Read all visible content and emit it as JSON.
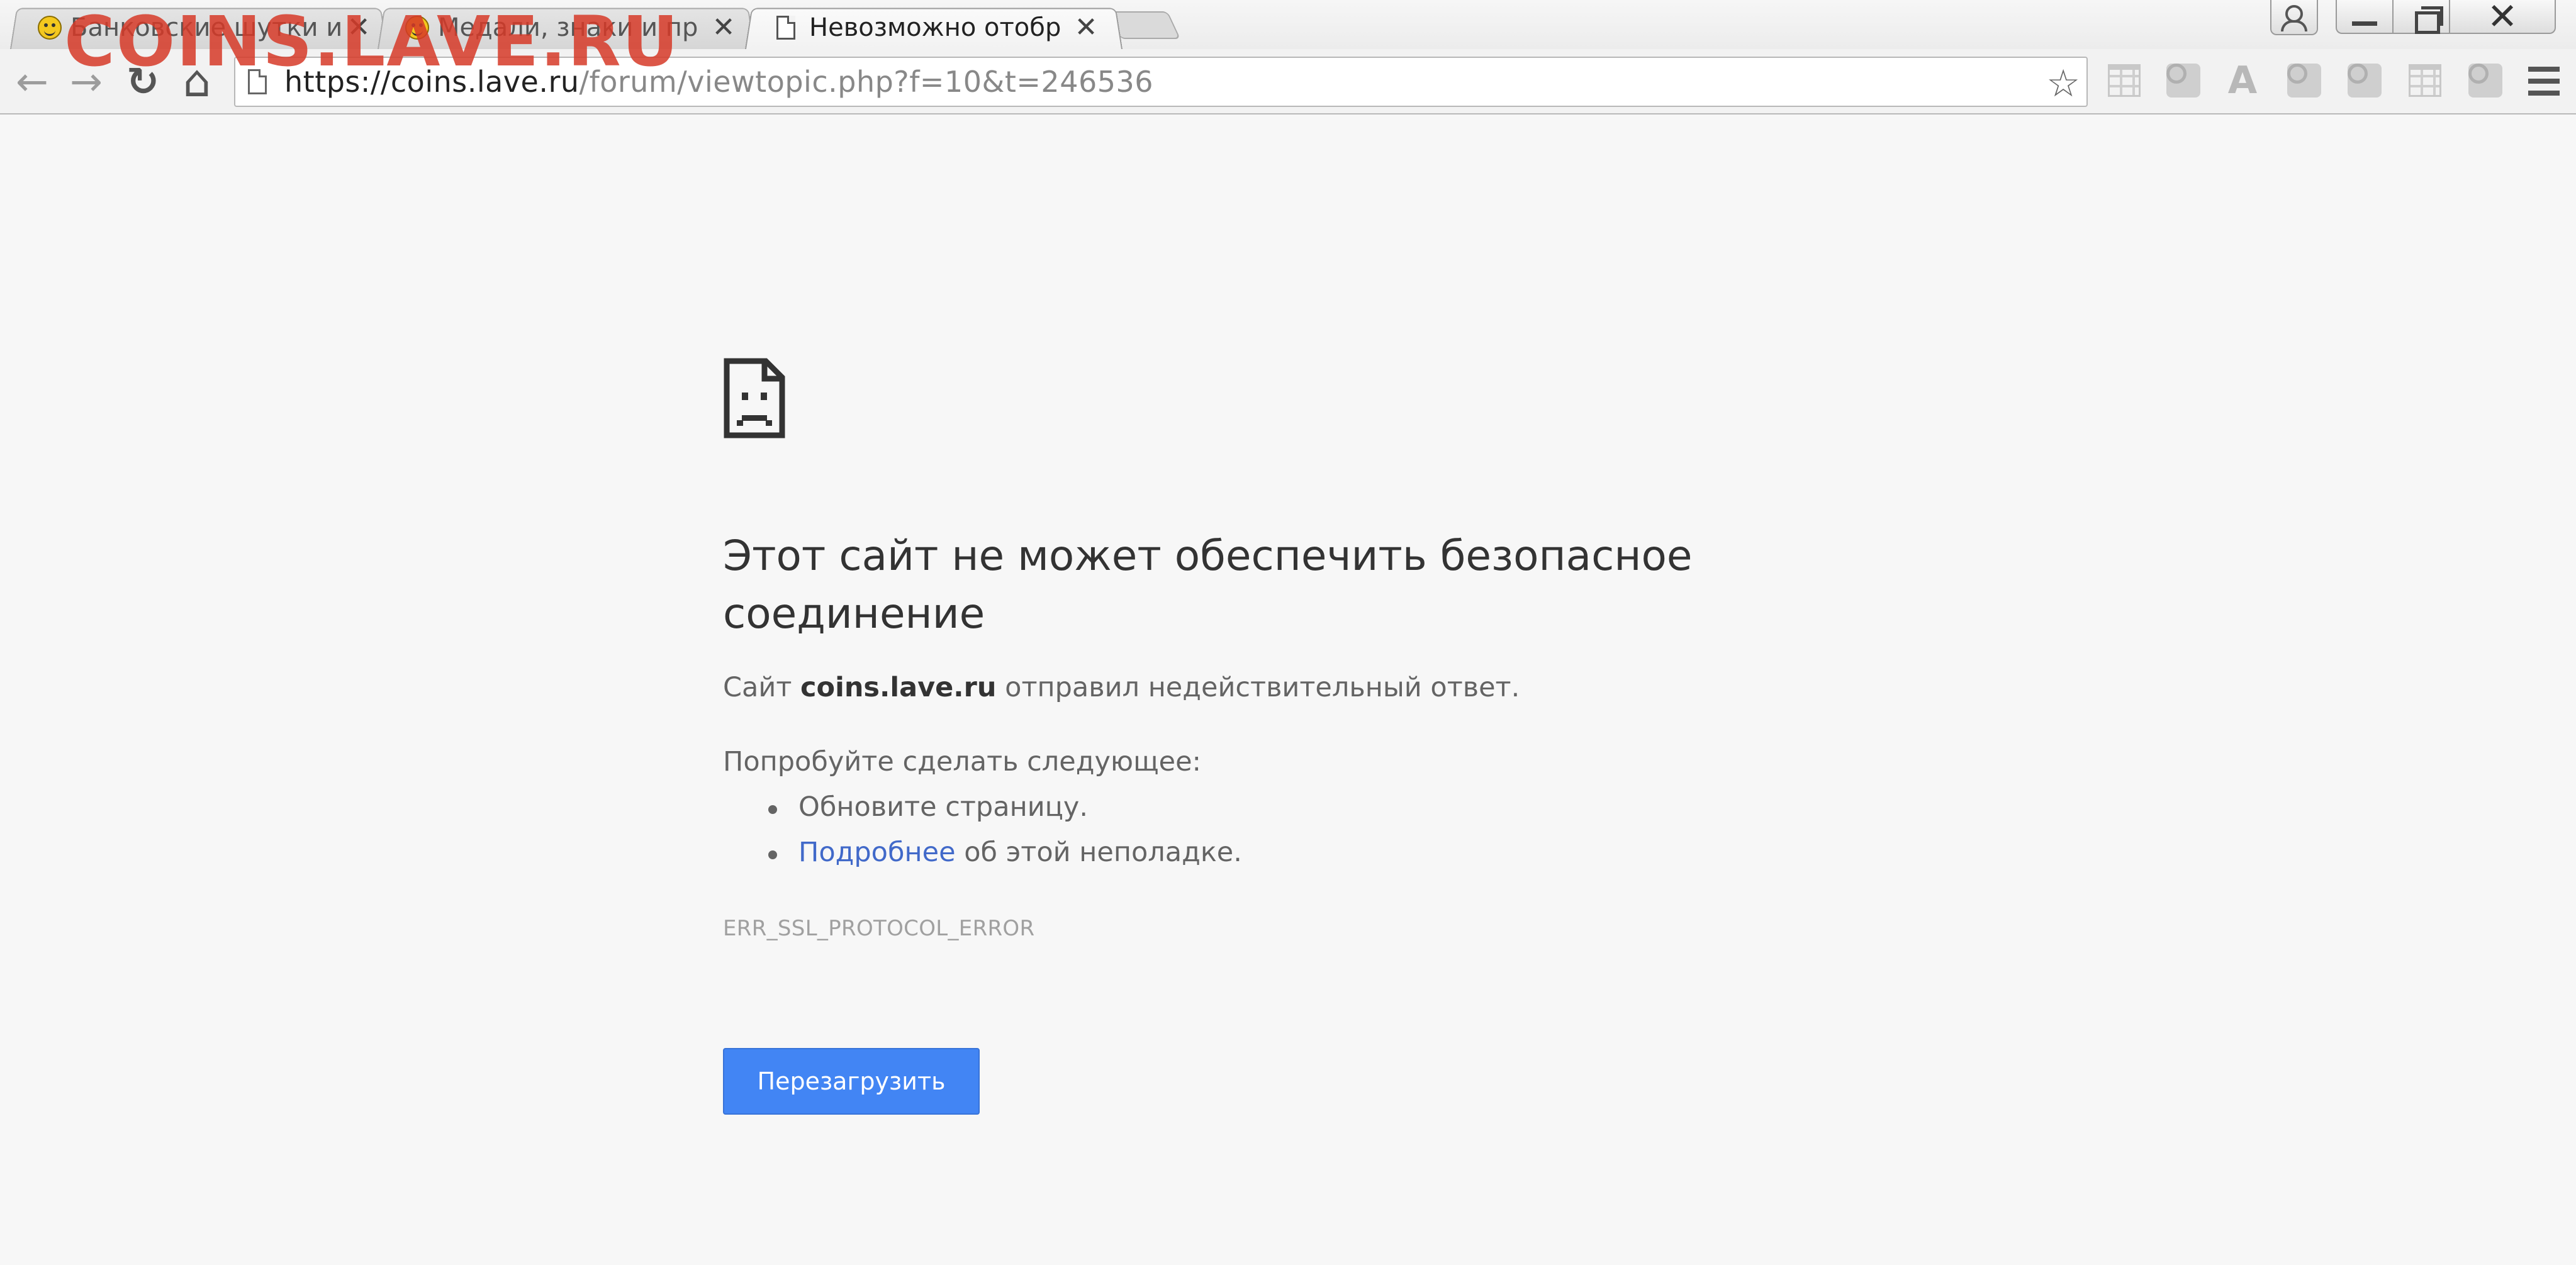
{
  "watermark": "COINS.LAVE.RU",
  "tabs": [
    {
      "title": "Банковские шутки и",
      "close": "✕"
    },
    {
      "title": "Медали, знаки и пр",
      "close": "✕"
    },
    {
      "title": "Невозможно отобр",
      "close": "✕"
    }
  ],
  "window": {
    "close": "✕"
  },
  "toolbar": {
    "back": "←",
    "forward": "→",
    "reload": "↻",
    "home": "⌂",
    "url_host": "https://coins.lave.ru",
    "url_rest": "/forum/viewtopic.php?f=10&t=246536",
    "star": "☆",
    "ext_a": "A"
  },
  "error": {
    "headline": "Этот сайт не может обеспечить безопасное соединение",
    "desc_pre": "Сайт ",
    "desc_host": "coins.lave.ru",
    "desc_post": " отправил недействительный ответ.",
    "try_label": "Попробуйте сделать следующее:",
    "suggestion_1": "Обновите страницу.",
    "suggestion_2_link": "Подробнее",
    "suggestion_2_rest": " об этой неполадке.",
    "code": "ERR_SSL_PROTOCOL_ERROR",
    "reload_button": "Перезагрузить"
  },
  "colors": {
    "page_bg": "#f7f7f7",
    "button_bg": "#4285f4",
    "link": "#4169c9",
    "watermark": "#d63a28"
  }
}
